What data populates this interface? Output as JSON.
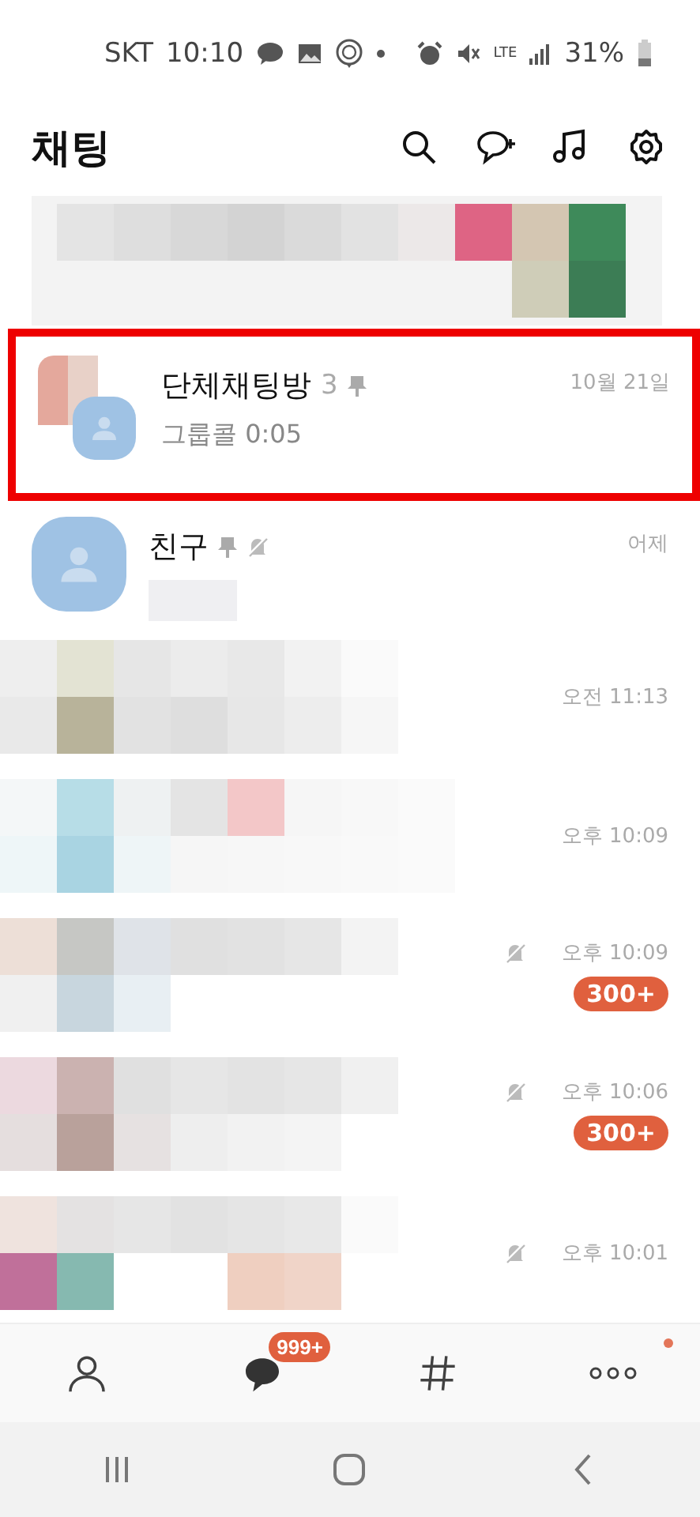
{
  "status_bar": {
    "carrier": "SKT",
    "time": "10:10",
    "battery": "31%",
    "network": "LTE"
  },
  "header": {
    "title": "채팅"
  },
  "chats": [
    {
      "kind": "normal",
      "name": "단체채팅방",
      "member_count": "3",
      "preview": "그룹콜 0:05",
      "time": "10월 21일",
      "pinned": true,
      "muted": false,
      "highlighted": true,
      "avatar": {
        "kind": "group"
      }
    },
    {
      "kind": "normal",
      "name": "친구",
      "time": "어제",
      "pinned": true,
      "muted": true,
      "highlighted": false,
      "avatar": {
        "kind": "single"
      }
    },
    {
      "kind": "blurred",
      "time": "오전 11:13",
      "muted": false
    },
    {
      "kind": "blurred",
      "time": "오후 10:09",
      "muted": false
    },
    {
      "kind": "blurred",
      "time": "오후 10:09",
      "muted": true,
      "badge": "300+"
    },
    {
      "kind": "blurred",
      "time": "오후 10:06",
      "muted": true,
      "badge": "300+"
    },
    {
      "kind": "blurred",
      "time": "오후 10:01",
      "muted": true
    }
  ],
  "bottom_nav": [
    {
      "kind": "friends",
      "selected": false
    },
    {
      "kind": "chats",
      "selected": true,
      "badge": "999+"
    },
    {
      "kind": "openchat",
      "selected": false
    },
    {
      "kind": "more",
      "selected": false,
      "dot": true
    }
  ]
}
